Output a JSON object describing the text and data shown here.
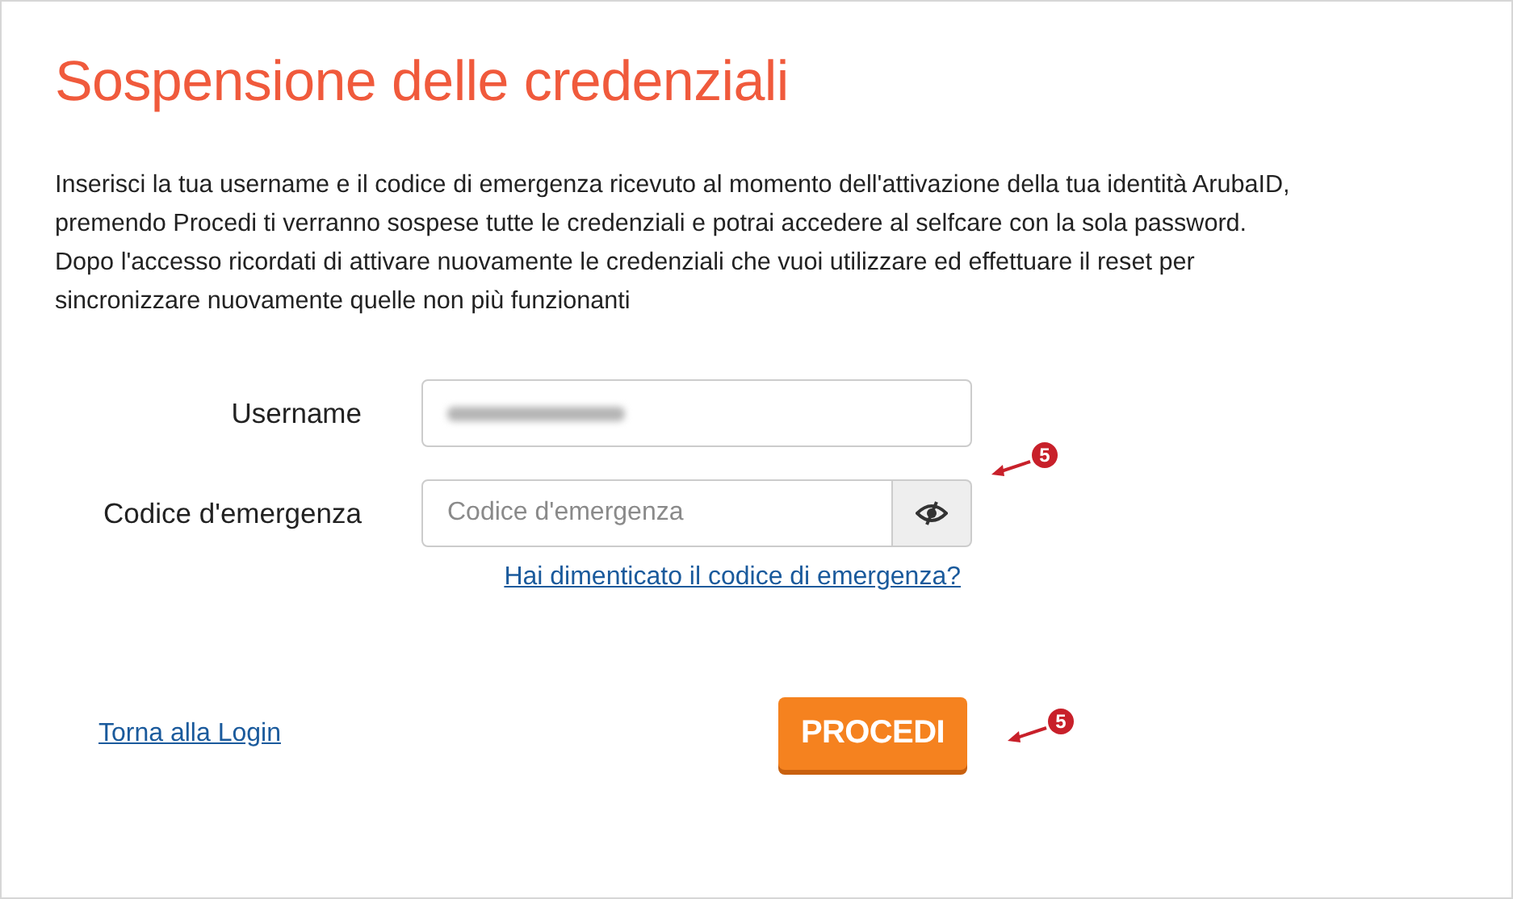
{
  "title": "Sospensione delle credenziali",
  "intro": [
    "Inserisci la tua username e il codice di emergenza ricevuto al momento dell'attivazione della tua identità ArubaID,",
    "premendo Procedi ti verranno sospese tutte le credenziali e potrai accedere al selfcare con la sola password.",
    "Dopo l'accesso ricordati di attivare nuovamente le credenziali che vuoi utilizzare ed effettuare il reset per",
    "sincronizzare nuovamente quelle non più funzionanti"
  ],
  "fields": [
    {
      "label": "Username",
      "blurred": true,
      "kind": "text"
    },
    {
      "label": "Codice d'emergenza",
      "placeholder": "Codice d'emergenza",
      "blurred": false,
      "kind": "secret"
    }
  ],
  "forgot_link": "Hai dimenticato il codice di emergenza?",
  "back_link": "Torna alla Login",
  "submit_button": "PROCEDI",
  "annotations": [
    {
      "label": "5"
    },
    {
      "label": "5"
    }
  ]
}
